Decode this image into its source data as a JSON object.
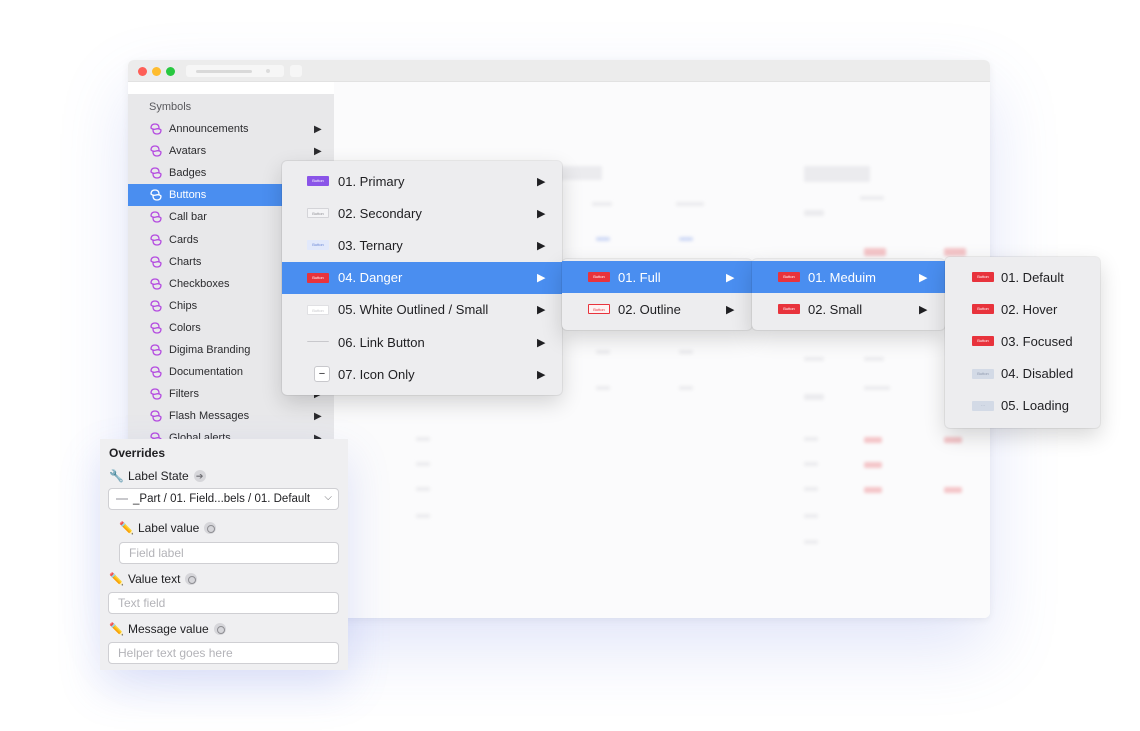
{
  "sidebar": {
    "header": "Symbols",
    "items": [
      {
        "label": "Announcements",
        "submenu": true
      },
      {
        "label": "Avatars",
        "submenu": true
      },
      {
        "label": "Badges",
        "submenu": true
      },
      {
        "label": "Buttons",
        "submenu": true,
        "active": true
      },
      {
        "label": "Call bar",
        "submenu": true
      },
      {
        "label": "Cards",
        "submenu": true
      },
      {
        "label": "Charts",
        "submenu": true
      },
      {
        "label": "Checkboxes",
        "submenu": true
      },
      {
        "label": "Chips",
        "submenu": true
      },
      {
        "label": "Colors",
        "submenu": true
      },
      {
        "label": "Digima Branding",
        "submenu": true
      },
      {
        "label": "Documentation",
        "submenu": true
      },
      {
        "label": "Filters",
        "submenu": true
      },
      {
        "label": "Flash Messages",
        "submenu": true
      },
      {
        "label": "Global alerts",
        "submenu": true
      }
    ]
  },
  "menus": {
    "buttons": [
      {
        "label": "01. Primary",
        "thumb": "primary",
        "thumb_text": "Button"
      },
      {
        "label": "02. Secondary",
        "thumb": "secondary",
        "thumb_text": "Button"
      },
      {
        "label": "03. Ternary",
        "thumb": "ternary",
        "thumb_text": "Button"
      },
      {
        "label": "04. Danger",
        "thumb": "danger",
        "thumb_text": "Button",
        "active": true
      },
      {
        "label": "05. White Outlined / Small",
        "thumb": "white",
        "thumb_text": "Button"
      },
      {
        "label": "06. Link Button",
        "thumb": "link",
        "thumb_text": ""
      },
      {
        "label": "07. Icon Only",
        "thumb": "icon",
        "thumb_text": "−"
      }
    ],
    "danger": [
      {
        "label": "01. Full",
        "thumb": "danger",
        "thumb_text": "Button",
        "active": true
      },
      {
        "label": "02. Outline",
        "thumb": "outline",
        "thumb_text": "Button"
      }
    ],
    "full": [
      {
        "label": "01. Meduim",
        "thumb": "danger",
        "thumb_text": "Button",
        "active": true
      },
      {
        "label": "02. Small",
        "thumb": "danger",
        "thumb_text": "Button"
      }
    ],
    "states": [
      {
        "label": "01. Default",
        "thumb": "danger",
        "thumb_text": "Button"
      },
      {
        "label": "02. Hover",
        "thumb": "danger",
        "thumb_text": "Button"
      },
      {
        "label": "03. Focused",
        "thumb": "danger",
        "thumb_text": "Button"
      },
      {
        "label": "04. Disabled",
        "thumb": "disabled",
        "thumb_text": "Button"
      },
      {
        "label": "05. Loading",
        "thumb": "loading",
        "thumb_text": "···"
      }
    ],
    "submenu_arrow": "▶"
  },
  "overrides": {
    "title": "Overrides",
    "label_state": {
      "label": "Label State",
      "icon": "wrench-icon",
      "value": "_Part / 01. Field...bels / 01. Default"
    },
    "label_value": {
      "label": "Label value",
      "icon": "pencil-icon",
      "placeholder": "Field label"
    },
    "value_text": {
      "label": "Value text",
      "icon": "pencil-icon",
      "placeholder": "Text field"
    },
    "message_value": {
      "label": "Message value",
      "icon": "pencil-icon",
      "placeholder": "Helper text goes here"
    }
  },
  "colors": {
    "accent": "#4a8ef0",
    "primary": "#8a54e8",
    "danger": "#e8333c",
    "symbol_icon": "#b44be0"
  }
}
